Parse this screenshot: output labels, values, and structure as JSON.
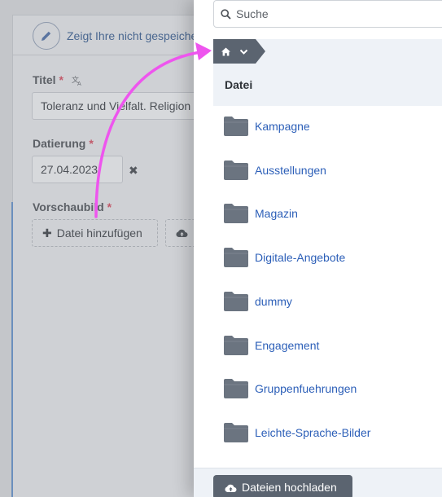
{
  "form": {
    "notice": "Zeigt Ihre nicht gespeicherten",
    "title_label": "Titel",
    "required_mark": "*",
    "title_value": "Toleranz und Vielfalt. Religion",
    "date_label": "Datierung",
    "date_value": "27.04.2023",
    "clear_glyph": "✖",
    "preview_label": "Vorschaubild",
    "add_file_button": "Datei hinzufügen",
    "add_glyph": "✚"
  },
  "browser": {
    "search_placeholder": "Suche",
    "column_header": "Datei",
    "folders": [
      "Kampagne",
      "Ausstellungen",
      "Magazin",
      "Digitale-Angebote",
      "dummy",
      "Engagement",
      "Gruppenfuehrungen",
      "Leichte-Sprache-Bilder"
    ],
    "upload_button": "Dateien hochladen"
  },
  "colors": {
    "accent_arrow": "#ee55ee",
    "link_blue": "#2c5fb8",
    "folder_gray": "#6b7480",
    "dark_button": "#5b6470"
  }
}
